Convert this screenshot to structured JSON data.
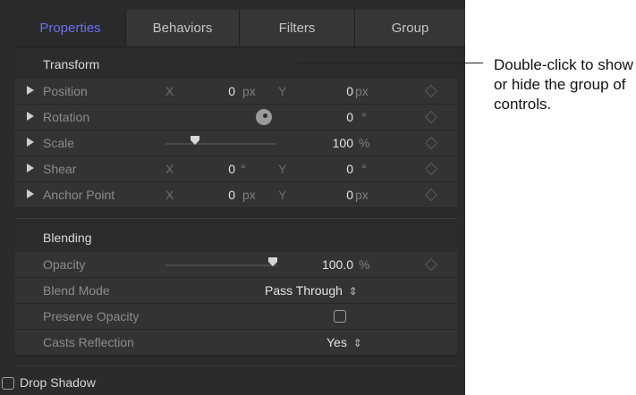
{
  "tabs": [
    {
      "label": "Properties",
      "active": true
    },
    {
      "label": "Behaviors",
      "active": false
    },
    {
      "label": "Filters",
      "active": false
    },
    {
      "label": "Group",
      "active": false
    }
  ],
  "transform": {
    "title": "Transform",
    "rows": {
      "position": {
        "label": "Position",
        "x_axis": "X",
        "x_value": "0",
        "x_unit": "px",
        "y_axis": "Y",
        "y_value": "0",
        "y_unit": "px"
      },
      "rotation": {
        "label": "Rotation",
        "value": "0",
        "unit": "°"
      },
      "scale": {
        "label": "Scale",
        "value": "100",
        "unit": "%",
        "slider_fraction": 0.33
      },
      "shear": {
        "label": "Shear",
        "x_axis": "X",
        "x_value": "0",
        "x_unit": "°",
        "y_axis": "Y",
        "y_value": "0",
        "y_unit": "°"
      },
      "anchor": {
        "label": "Anchor Point",
        "x_axis": "X",
        "x_value": "0",
        "x_unit": "px",
        "y_axis": "Y",
        "y_value": "0",
        "y_unit": "px"
      }
    }
  },
  "blending": {
    "title": "Blending",
    "opacity": {
      "label": "Opacity",
      "value": "100.0",
      "unit": "%",
      "slider_fraction": 1.0
    },
    "blend_mode": {
      "label": "Blend Mode",
      "value": "Pass Through"
    },
    "preserve_opacity": {
      "label": "Preserve Opacity",
      "checked": false
    },
    "casts_reflection": {
      "label": "Casts Reflection",
      "value": "Yes"
    }
  },
  "drop_shadow": {
    "label": "Drop Shadow",
    "checked": false
  },
  "callout": {
    "text": "Double-click to show or hide the group of controls."
  },
  "colors": {
    "accent": "#6e6ef2",
    "panel_bg": "#2b2b2b",
    "row_bg": "#333333"
  }
}
